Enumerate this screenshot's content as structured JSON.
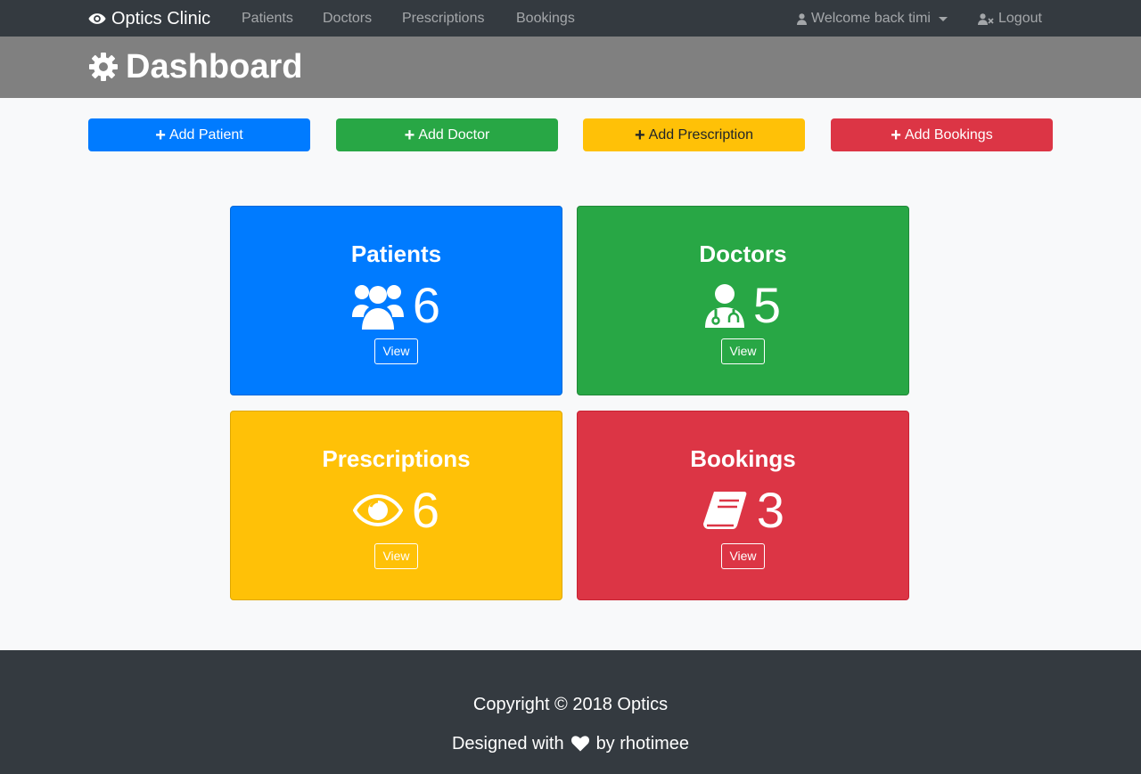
{
  "navbar": {
    "brand": "Optics Clinic",
    "brand_icon": "eye-icon",
    "links": [
      "Patients",
      "Doctors",
      "Prescriptions",
      "Bookings"
    ],
    "user_menu": "Welcome back timi",
    "logout": "Logout"
  },
  "header": {
    "title": "Dashboard",
    "icon": "gear-icon"
  },
  "actions": {
    "add_patient": "Add Patient",
    "add_doctor": "Add Doctor",
    "add_prescription": "Add Prescription",
    "add_bookings": "Add Bookings"
  },
  "cards": {
    "patients": {
      "title": "Patients",
      "count": "6",
      "button": "View",
      "icon": "users-icon"
    },
    "doctors": {
      "title": "Doctors",
      "count": "5",
      "button": "View",
      "icon": "doctor-icon"
    },
    "prescriptions": {
      "title": "Prescriptions",
      "count": "6",
      "button": "View",
      "icon": "eye-icon"
    },
    "bookings": {
      "title": "Bookings",
      "count": "3",
      "button": "View",
      "icon": "book-icon"
    }
  },
  "footer": {
    "copyright": "Copyright © 2018 Optics",
    "designed_prefix": "Designed with",
    "designed_suffix": "by rhotimee"
  },
  "colors": {
    "primary": "#007bff",
    "success": "#28a745",
    "warning": "#ffc107",
    "danger": "#dc3545",
    "dark": "#343a40",
    "header_gray": "#808080"
  }
}
